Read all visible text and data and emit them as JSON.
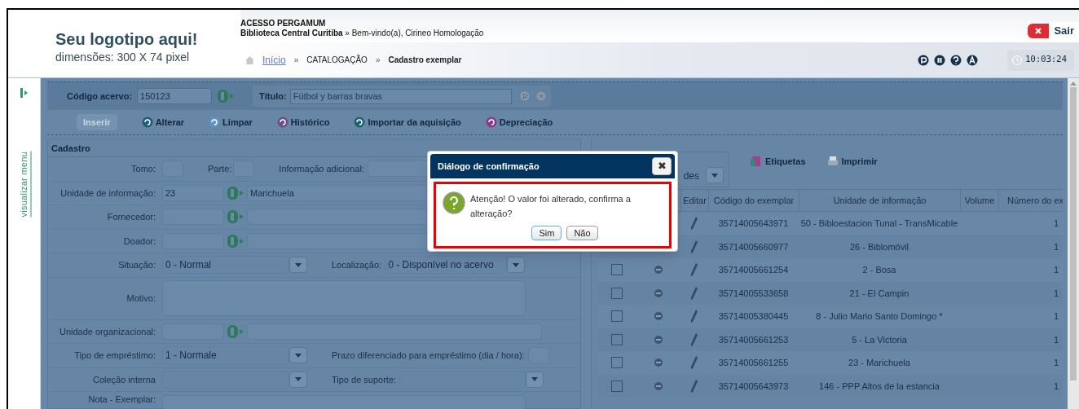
{
  "header": {
    "logo_title": "Seu logotipo aqui!",
    "logo_subtitle": "dimensões: 300 X 74 pixel",
    "app_name": "ACESSO PERGAMUM",
    "library": "Biblioteca Central Curitiba",
    "separator": "»",
    "welcome": "Bem-vindo(a), Cirineo Homologação",
    "exit_button": "Sair",
    "clock": "10:03:24",
    "breadcrumb": [
      {
        "label": "Início",
        "kind": "link"
      },
      {
        "label": "CATALOGAÇÃO",
        "kind": "text"
      },
      {
        "label": "Cadastro exemplar",
        "kind": "current"
      }
    ]
  },
  "sidebar": {
    "toggle_label": "visualizar menu"
  },
  "search": {
    "code_label": "Código acervo:",
    "code_value": "150123",
    "title_label": "Título:",
    "title_value": "Fútbol y barras bravas"
  },
  "toolbar": [
    {
      "label": "Inserir",
      "disabled": true
    },
    {
      "label": "Alterar",
      "disabled": false
    },
    {
      "label": "Limpar",
      "disabled": false
    },
    {
      "label": "Histórico",
      "disabled": false
    },
    {
      "label": "Importar da aquisição",
      "disabled": false
    },
    {
      "label": "Depreciação",
      "disabled": false
    }
  ],
  "form": {
    "title": "Cadastro",
    "rows": [
      [
        {
          "label": "Tomo:",
          "kind": "short"
        },
        {
          "label": "Parte:",
          "kind": "short"
        },
        {
          "label": "Informação adicional:",
          "kind": "text"
        }
      ],
      [
        {
          "label": "Unidade de informação:",
          "kind": "lookup",
          "value": "23",
          "name": "Marichuela"
        }
      ],
      [
        {
          "label": "Fornecedor:",
          "kind": "lookup"
        }
      ],
      [
        {
          "label": "Doador:",
          "kind": "lookup"
        }
      ],
      [
        {
          "label": "Situação:",
          "kind": "select",
          "value": "0 - Normal"
        },
        {
          "label": "Localização:",
          "kind": "select",
          "value": "0 - Disponível no acervo"
        }
      ],
      [
        {
          "label": "Motivo:",
          "kind": "textarea"
        }
      ],
      [
        {
          "label": "Unidade organizacional:",
          "kind": "lookup"
        }
      ],
      [
        {
          "label": "Tipo de empréstimo:",
          "kind": "select",
          "value": "1 - Normale"
        },
        {
          "label": "Prazo diferenciado para empréstimo (dia / hora):",
          "kind": "short"
        }
      ],
      [
        {
          "label": "Coleção interna",
          "kind": "select"
        },
        {
          "label": "Tipo de suporte:",
          "kind": "select"
        }
      ],
      [
        {
          "label": "Nota - Exemplar:",
          "kind": "textarea"
        }
      ]
    ]
  },
  "copies": {
    "filter_fragment": "des",
    "buttons": [
      {
        "label": "Etiquetas",
        "kind": "labels"
      },
      {
        "label": "Imprimir",
        "kind": "print"
      }
    ],
    "columns": [
      "Editar",
      "Código do exemplar",
      "Unidade de informação",
      "Volume",
      "Número do ex"
    ],
    "rows": [
      {
        "code": "35714005643971",
        "unit": "50 - Bibloestacion Tunal - TransMicable",
        "number": "1"
      },
      {
        "code": "35714005660977",
        "unit": "26 - Biblomóvil",
        "number": "1"
      },
      {
        "checked": false,
        "code": "35714005661254",
        "unit": "2 - Bosa",
        "number": "1"
      },
      {
        "checked": false,
        "code": "35714005533658",
        "unit": "21 - El Campin",
        "number": "1"
      },
      {
        "checked": false,
        "code": "35714005380445",
        "unit": "8 - Julio Mario Santo Domingo *",
        "number": "1"
      },
      {
        "checked": false,
        "code": "35714005661253",
        "unit": "5 - La Victoria",
        "number": "1"
      },
      {
        "checked": false,
        "code": "35714005661255",
        "unit": "23 - Marichuela",
        "number": "1"
      },
      {
        "checked": false,
        "code": "35714005643973",
        "unit": "146 - PPP Altos de la estancia",
        "number": "1"
      }
    ]
  },
  "dialog": {
    "title": "Diálogo de confirmação",
    "message": "Atenção! O valor foi alterado, confirma a alteração?",
    "close": "✖",
    "buttons": [
      {
        "label": "Sim",
        "focused": true
      },
      {
        "label": "Não",
        "focused": false
      }
    ]
  }
}
